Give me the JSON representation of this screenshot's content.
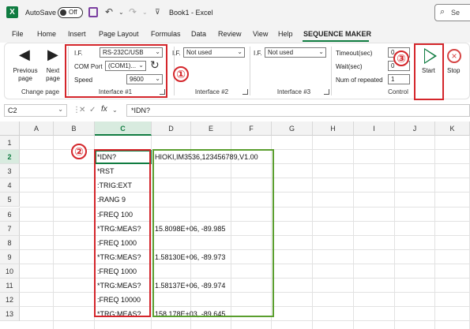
{
  "titlebar": {
    "autosave_label": "AutoSave",
    "toggle_state": "Off",
    "title": "Book1  -  Excel",
    "search_placeholder": "Se"
  },
  "tabs": [
    "File",
    "Home",
    "Insert",
    "Page Layout",
    "Formulas",
    "Data",
    "Review",
    "View",
    "Help",
    "SEQUENCE MAKER"
  ],
  "active_tab": "SEQUENCE MAKER",
  "ribbon": {
    "change_page": {
      "previous": "Previous page",
      "next": "Next page",
      "group_label": "Change page"
    },
    "interface1": {
      "if_label": "I.F.",
      "if_value": "RS-232C/USB",
      "com_label": "COM Port",
      "com_value": "(COM1)...",
      "speed_label": "Speed",
      "speed_value": "9600",
      "group_label": "Interface #1"
    },
    "interface2": {
      "if_label": "I.F.",
      "if_value": "Not used",
      "group_label": "Interface #2"
    },
    "interface3": {
      "if_label": "I.F.",
      "if_value": "Not used",
      "group_label": "Interface #3"
    },
    "control": {
      "timeout_label": "Timeout(sec)",
      "timeout_value": "0",
      "wait_label": "Wait(sec)",
      "wait_value": "0",
      "repeat_label": "Num of repeated",
      "repeat_value": "1",
      "group_label": "Control"
    },
    "start_label": "Start",
    "stop_label": "Stop"
  },
  "annotations": {
    "one": "①",
    "two": "②",
    "three": "③"
  },
  "formula_bar": {
    "cell_ref": "C2",
    "fx": "fx",
    "content": "*IDN?"
  },
  "sheet": {
    "columns": [
      "A",
      "B",
      "C",
      "D",
      "E",
      "F",
      "G",
      "H",
      "I",
      "J",
      "K"
    ],
    "rows": [
      "1",
      "2",
      "3",
      "4",
      "5",
      "6",
      "7",
      "8",
      "9",
      "10",
      "11",
      "12",
      "13"
    ],
    "commands": [
      "",
      "*IDN?",
      "*RST",
      ":TRIG:EXT",
      ":RANG 9",
      ":FREQ 100",
      "*TRG:MEAS?",
      ":FREQ 1000",
      "*TRG:MEAS?",
      ":FREQ 1000",
      "*TRG:MEAS?",
      ":FREQ 10000",
      "*TRG:MEAS?"
    ],
    "responses": [
      "",
      "HIOKI,IM3536,123456789,V1.00",
      "",
      "",
      "",
      "",
      "15.8098E+06, -89.985",
      "",
      "1.58130E+06, -89.973",
      "",
      "1.58137E+06, -89.974",
      "",
      "158.178E+03, -89.645"
    ]
  },
  "colors": {
    "excel_green": "#107c41",
    "annotation_red": "#d4262b",
    "response_box_green": "#5a9e2e"
  }
}
